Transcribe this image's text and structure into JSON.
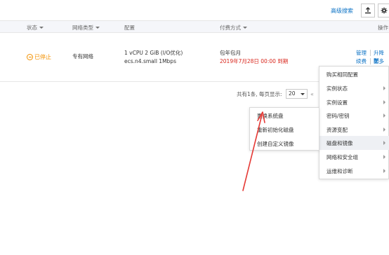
{
  "toolbar": {
    "advanced_search": "高级搜索",
    "export_icon": "export-icon",
    "settings_icon": "gear-icon"
  },
  "table": {
    "headers": {
      "status": "状态",
      "network_type": "网络类型",
      "config": "配置",
      "billing": "付费方式",
      "actions": "操作"
    },
    "row": {
      "status": "已停止",
      "network": "专有网络",
      "config_line1": "1 vCPU 2 GiB (I/O优化)",
      "config_line2": "ecs.n4.small   1Mbps",
      "billing_type": "包年包月",
      "expiry": "2019年7月28日 00:00 到期",
      "action_manage": "管理",
      "action_upgrade": "升降配",
      "action_renew": "续费",
      "action_more": "更多"
    }
  },
  "pager": {
    "summary": "共有1条, 每页显示:",
    "page_size": "20",
    "prev": "«"
  },
  "menu": {
    "items": [
      "购买相同配置",
      "实例状态",
      "实例设置",
      "密码/密钥",
      "资源变配",
      "磁盘和镜像",
      "网络和安全组",
      "运维和诊断"
    ]
  },
  "submenu": {
    "items": [
      "更换系统盘",
      "重新初始化磁盘",
      "创建自定义镜像"
    ]
  },
  "colors": {
    "link": "#0b72c5",
    "warning": "#f39100",
    "expiry": "#d9261c",
    "annotation": "#e53935"
  }
}
